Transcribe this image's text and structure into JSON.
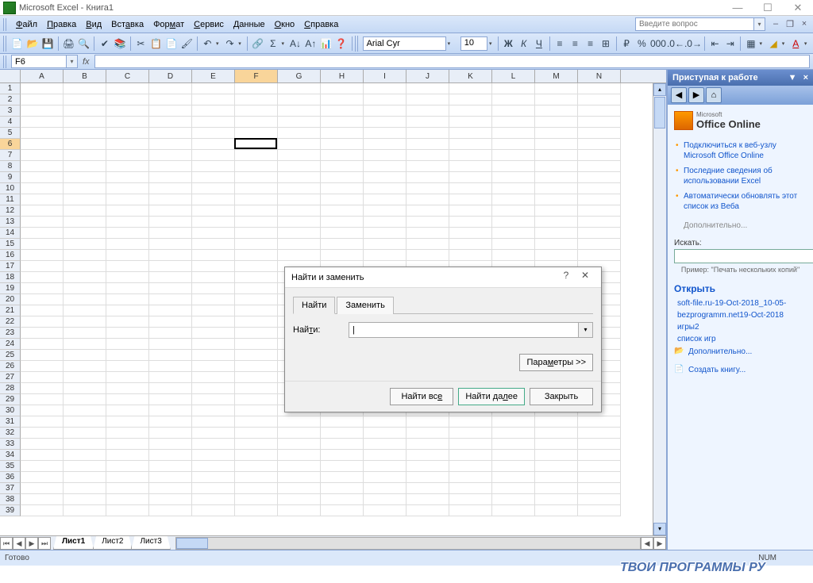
{
  "titlebar": {
    "app": "Microsoft Excel",
    "doc": "Книга1"
  },
  "menubar": {
    "items": [
      "Файл",
      "Правка",
      "Вид",
      "Вставка",
      "Формат",
      "Сервис",
      "Данные",
      "Окно",
      "Справка"
    ],
    "help_placeholder": "Введите вопрос"
  },
  "toolbar": {
    "font_name": "Arial Cyr",
    "font_size": "10"
  },
  "formula": {
    "name_box": "F6"
  },
  "grid": {
    "columns": [
      "A",
      "B",
      "C",
      "D",
      "E",
      "F",
      "G",
      "H",
      "I",
      "J",
      "K",
      "L",
      "M",
      "N"
    ],
    "row_count": 39,
    "active_col": "F",
    "active_row": 6
  },
  "tabs": {
    "sheets": [
      "Лист1",
      "Лист2",
      "Лист3"
    ],
    "active": 0
  },
  "taskpane": {
    "header": "Приступая к работе",
    "online": {
      "brand_small": "Microsoft",
      "brand": "Office Online"
    },
    "links": [
      "Подключиться к веб-узлу Microsoft Office Online",
      "Последние сведения об использовании Excel",
      "Автоматически обновлять этот список из Веба"
    ],
    "more": "Дополнительно...",
    "search_label": "Искать:",
    "example": "Пример: \"Печать нескольких копий\"",
    "open_header": "Открыть",
    "recent": [
      "soft-file.ru-19-Oct-2018_10-05-",
      "bezprogramm.net19-Oct-2018",
      "игры2",
      "список игр"
    ],
    "open_more": "Дополнительно...",
    "create": "Создать книгу..."
  },
  "dialog": {
    "title": "Найти и заменить",
    "tab_find": "Найти",
    "tab_replace": "Заменить",
    "find_label": "Найти:",
    "options": "Параметры >>",
    "find_all": "Найти все",
    "find_next": "Найти далее",
    "close": "Закрыть"
  },
  "status": {
    "ready": "Готово",
    "num": "NUM"
  },
  "watermark": "ТВОИ ПРОГРАММЫ РУ"
}
